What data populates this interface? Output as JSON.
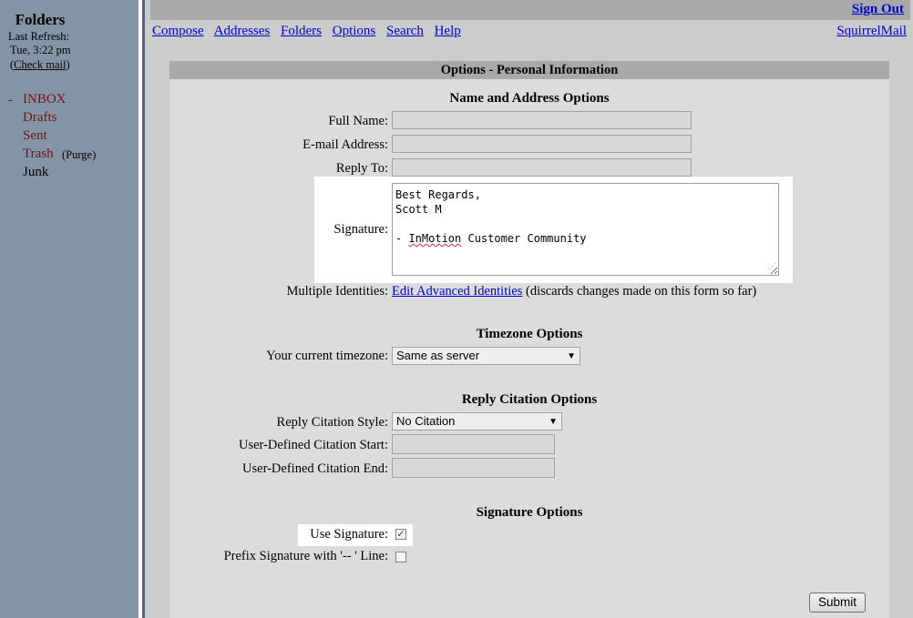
{
  "left": {
    "title": "Folders",
    "last_refresh_label": "Last Refresh:",
    "time": "Tue, 3:22 pm",
    "check_open": "(",
    "check_mail": "Check mail",
    "check_close": ")",
    "inbox_marker": "-",
    "folders": [
      {
        "name": "INBOX"
      },
      {
        "name": "Drafts"
      },
      {
        "name": "Sent"
      },
      {
        "name": "Trash"
      },
      {
        "name": "Junk"
      }
    ],
    "purge": "(Purge)"
  },
  "header": {
    "sign_out": "Sign Out",
    "menu": [
      "Compose",
      "Addresses",
      "Folders",
      "Options",
      "Search",
      "Help"
    ],
    "brand_link": "SquirrelMail"
  },
  "panel": {
    "title": "Options - Personal Information",
    "name_address": {
      "heading": "Name and Address Options",
      "full_name_label": "Full Name:",
      "full_name_value": "",
      "email_label": "E-mail Address:",
      "email_value": "",
      "reply_to_label": "Reply To:",
      "reply_to_value": "",
      "signature_label": "Signature:",
      "signature_value": "Best Regards,\nScott M\n\n- InMotion Customer Community",
      "identities_label": "Multiple Identities:",
      "identities_link": "Edit Advanced Identities",
      "identities_note": "(discards changes made on this form so far)"
    },
    "timezone": {
      "heading": "Timezone Options",
      "label": "Your current timezone:",
      "selected": "Same as server"
    },
    "citation": {
      "heading": "Reply Citation Options",
      "style_label": "Reply Citation Style:",
      "style_selected": "No Citation",
      "start_label": "User-Defined Citation Start:",
      "start_value": "",
      "end_label": "User-Defined Citation End:",
      "end_value": ""
    },
    "signature_opts": {
      "heading": "Signature Options",
      "use_label": "Use Signature:",
      "use_checked": true,
      "prefix_label": "Prefix Signature with '-- ' Line:",
      "prefix_checked": false
    },
    "submit_label": "Submit"
  },
  "colors": {
    "left_pane": "#8395a7",
    "folder_link": "#7a1010",
    "link": "#0000cc",
    "panel_bg": "#dcdcdc",
    "title_bar": "#a9a9a9"
  }
}
